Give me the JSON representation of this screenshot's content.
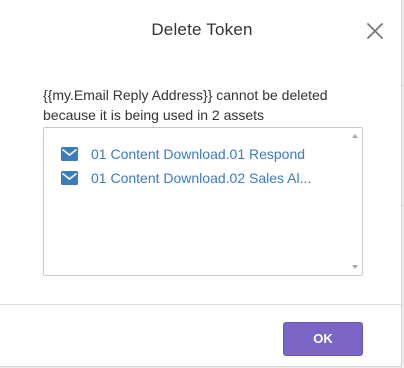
{
  "dialog": {
    "title": "Delete Token",
    "close_icon": "close-icon",
    "message": "{{my.Email Reply Address}} cannot be deleted because it is being used in 2 assets",
    "assets": [
      {
        "icon": "email-icon",
        "label": "01 Content Download.01 Respond"
      },
      {
        "icon": "email-icon",
        "label": "01 Content Download.02 Sales Al..."
      }
    ],
    "ok_label": "OK"
  },
  "colors": {
    "link": "#3b7bbf",
    "primary_button": "#7b66c5",
    "email_icon": "#3b7bbf"
  }
}
